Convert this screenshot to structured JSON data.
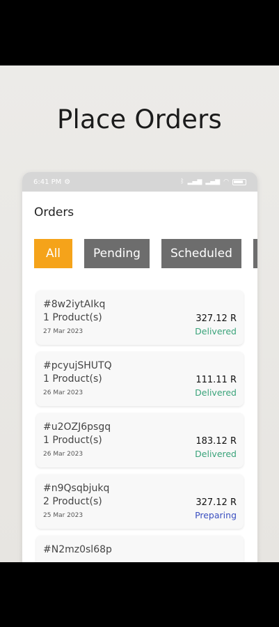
{
  "headline": "Place Orders",
  "statusbar": {
    "time": "6:41 PM",
    "right_text": "Vo Vo"
  },
  "app": {
    "title": "Orders"
  },
  "filters": [
    {
      "label": "All",
      "state": "active"
    },
    {
      "label": "Pending",
      "state": "inactive"
    },
    {
      "label": "Scheduled",
      "state": "inactive"
    }
  ],
  "orders": [
    {
      "code": "#8w2iytAIkq",
      "products": "1 Product(s)",
      "date": "27 Mar 2023",
      "amount": "327.12 R",
      "status": "Delivered"
    },
    {
      "code": "#pcyujSHUTQ",
      "products": "1 Product(s)",
      "date": "26 Mar 2023",
      "amount": "111.11 R",
      "status": "Delivered"
    },
    {
      "code": "#u2OZJ6psgq",
      "products": "1 Product(s)",
      "date": "26 Mar 2023",
      "amount": "183.12 R",
      "status": "Delivered"
    },
    {
      "code": "#n9Qsqbjukq",
      "products": "2 Product(s)",
      "date": "25 Mar 2023",
      "amount": "327.12 R",
      "status": "Preparing"
    },
    {
      "code": "#N2mz0sl68p",
      "products": "",
      "date": "",
      "amount": "",
      "status": ""
    }
  ],
  "colors": {
    "accent": "#f5a31a",
    "chip_inactive": "#6d6d6d",
    "delivered": "#3aa37a",
    "preparing": "#3a4fc0"
  }
}
